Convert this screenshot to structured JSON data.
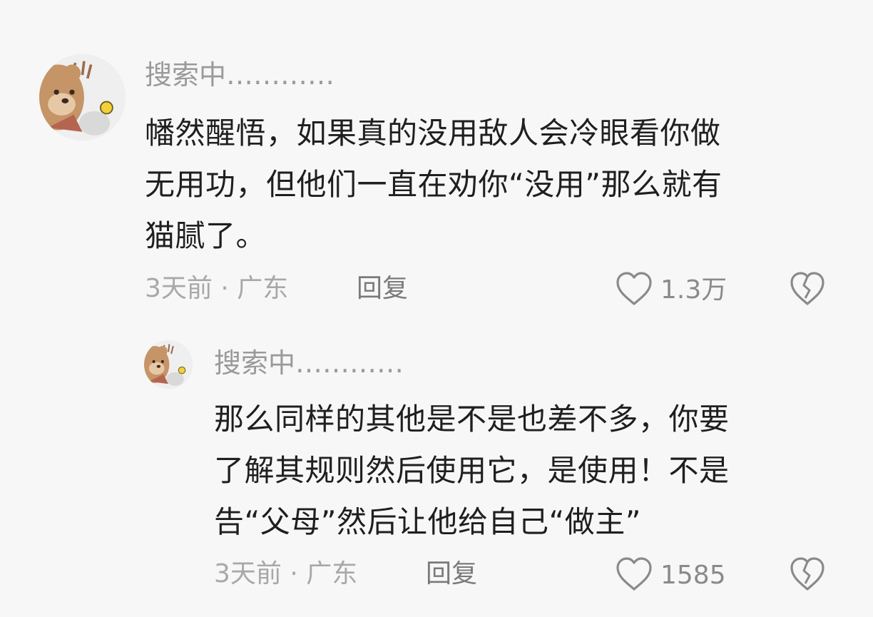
{
  "comments": [
    {
      "username": "搜索中…………",
      "lines": [
        "幡然醒悟，如果真的没用敌人会冷眼看你做",
        "无用功，但他们一直在劝你“没用”那么就有",
        "猫腻了。"
      ],
      "meta": "3天前 · 广东",
      "reply_label": "回复",
      "like_count": "1.3万"
    },
    {
      "username": "搜索中…………",
      "lines": [
        "那么同样的其他是不是也差不多，你要",
        "了解其规则然后使用它，是使用！不是",
        "告“父母”然后让他给自己“做主”"
      ],
      "meta": "3天前 · 广东",
      "reply_label": "回复",
      "like_count": "1585"
    }
  ],
  "icons": {
    "like": "heart-outline-icon",
    "dislike": "broken-heart-icon",
    "avatar": "bear-avatar"
  },
  "colors": {
    "background": "#f7f7f7",
    "text": "#1f1f1f",
    "muted": "#9a9a9a"
  }
}
